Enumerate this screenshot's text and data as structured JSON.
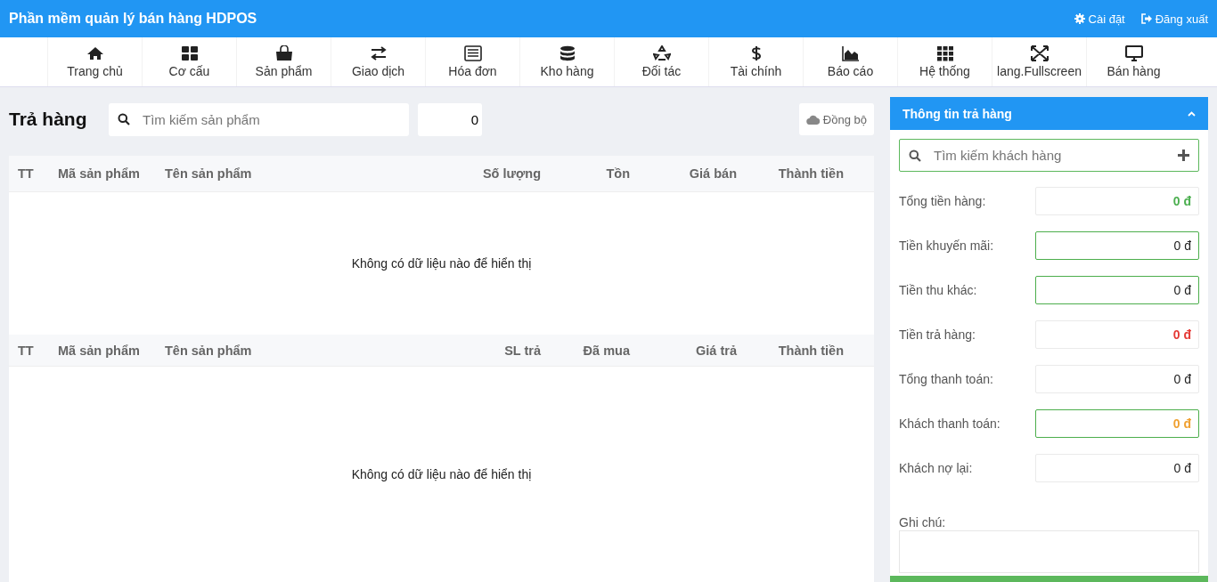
{
  "app_title": "Phần mềm quản lý bán hàng HDPOS",
  "header_links": [
    {
      "label": "Cài đặt"
    },
    {
      "label": "Đăng xuất"
    }
  ],
  "nav": [
    {
      "label": "Trang chủ"
    },
    {
      "label": "Cơ cấu"
    },
    {
      "label": "Sản phẩm"
    },
    {
      "label": "Giao dịch"
    },
    {
      "label": "Hóa đơn"
    },
    {
      "label": "Kho hàng"
    },
    {
      "label": "Đối tác"
    },
    {
      "label": "Tài chính"
    },
    {
      "label": "Báo cáo"
    },
    {
      "label": "Hệ thống"
    },
    {
      "label": "lang.Fullscreen"
    },
    {
      "label": "Bán hàng"
    }
  ],
  "page_title": "Trả hàng",
  "product_search": {
    "placeholder": "Tìm kiếm sản phẩm"
  },
  "quantity": "0",
  "sync_button": "Đồng bộ",
  "tables": [
    {
      "columns": [
        "TT",
        "Mã sản phẩm",
        "Tên sản phẩm",
        "Số lượng",
        "Tồn",
        "Giá bán",
        "Thành tiền"
      ],
      "empty_text": "Không có dữ liệu nào để hiển thị"
    },
    {
      "columns": [
        "TT",
        "Mã sản phẩm",
        "Tên sản phẩm",
        "SL trả",
        "Đã mua",
        "Giá trả",
        "Thành tiền"
      ],
      "empty_text": "Không có dữ liệu nào để hiển thị"
    }
  ],
  "panel": {
    "title": "Thông tin trả hàng",
    "expanded": true,
    "customer_search": {
      "placeholder": "Tìm kiếm khách hàng"
    },
    "fields": [
      {
        "label": "Tổng tiền hàng:",
        "value": "0 đ",
        "color": "#4caf50",
        "highlighted": false
      },
      {
        "label": "Tiền khuyến mãi:",
        "value": "0 đ",
        "highlighted": true
      },
      {
        "label": "Tiền thu khác:",
        "value": "0 đ",
        "highlighted": true
      },
      {
        "label": "Tiền trả hàng:",
        "value": "0 đ",
        "color": "#e53935",
        "highlighted": false
      },
      {
        "label": "Tổng thanh toán:",
        "value": "0 đ",
        "highlighted": false
      },
      {
        "label": "Khách thanh toán:",
        "value": "0 đ",
        "color": "#f0a030",
        "highlighted": true
      },
      {
        "label": "Khách nợ lại:",
        "value": "0 đ",
        "highlighted": false
      }
    ],
    "note_label": "Ghi chú:"
  }
}
